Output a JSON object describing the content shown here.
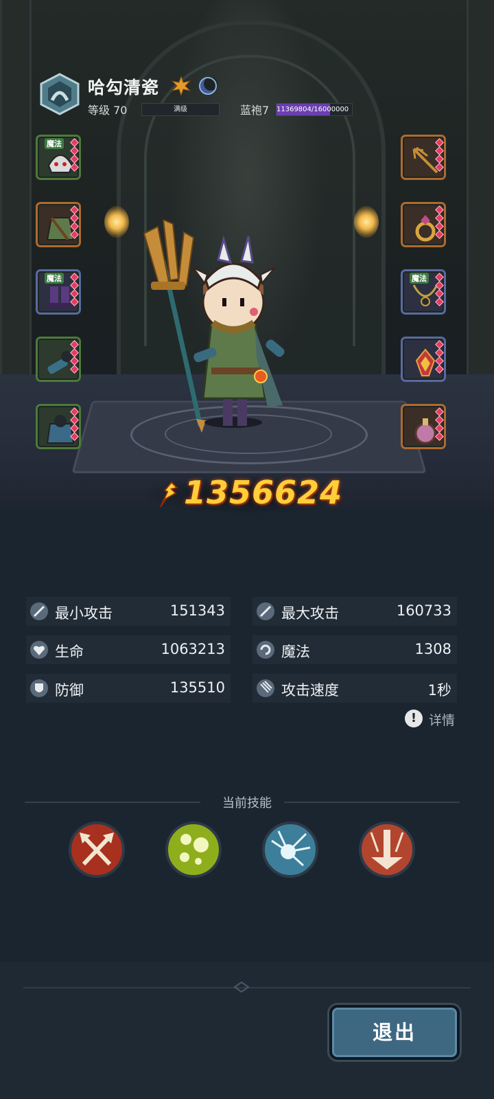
{
  "hero": {
    "name": "哈勾清瓷",
    "level_label": "等级 70",
    "level_bar_label": "满级",
    "rank_label": "蓝袍7",
    "exp_text": "11369804/16000000",
    "exp_fraction": 0.7106
  },
  "equipment": {
    "left": [
      {
        "name": "helmet",
        "tag": "魔法",
        "rarity": "green"
      },
      {
        "name": "armor",
        "tag": "",
        "rarity": "orange"
      },
      {
        "name": "boots",
        "tag": "魔法",
        "rarity": "purple"
      },
      {
        "name": "gloves",
        "tag": "",
        "rarity": "green"
      },
      {
        "name": "cape",
        "tag": "",
        "rarity": "green"
      }
    ],
    "right": [
      {
        "name": "weapon",
        "tag": "",
        "rarity": "orange"
      },
      {
        "name": "ring",
        "tag": "",
        "rarity": "orange"
      },
      {
        "name": "necklace",
        "tag": "魔法",
        "rarity": "purple"
      },
      {
        "name": "charm",
        "tag": "",
        "rarity": "purple"
      },
      {
        "name": "potion",
        "tag": "",
        "rarity": "orange"
      }
    ]
  },
  "power": {
    "value": "1356624"
  },
  "stats": {
    "min_attack": {
      "label": "最小攻击",
      "value": "151343"
    },
    "max_attack": {
      "label": "最大攻击",
      "value": "160733"
    },
    "hp": {
      "label": "生命",
      "value": "1063213"
    },
    "magic": {
      "label": "魔法",
      "value": "1308"
    },
    "defense": {
      "label": "防御",
      "value": "135510"
    },
    "attack_speed": {
      "label": "攻击速度",
      "value": "1秒"
    }
  },
  "details_label": "详情",
  "skills": {
    "title": "当前技能",
    "items": [
      {
        "icon": "crossed-axes-icon",
        "color": "#a8301f"
      },
      {
        "icon": "poison-bubbles-icon",
        "color": "#8fae1c"
      },
      {
        "icon": "ice-burst-icon",
        "color": "#3d7f9a"
      },
      {
        "icon": "sword-strike-icon",
        "color": "#b2452e"
      }
    ]
  },
  "exit_label": "退出",
  "colors": {
    "power": "#ffcf3a",
    "exp_fill": "#6b3fb0",
    "button": "#3e6782",
    "background": "#1b2530"
  }
}
